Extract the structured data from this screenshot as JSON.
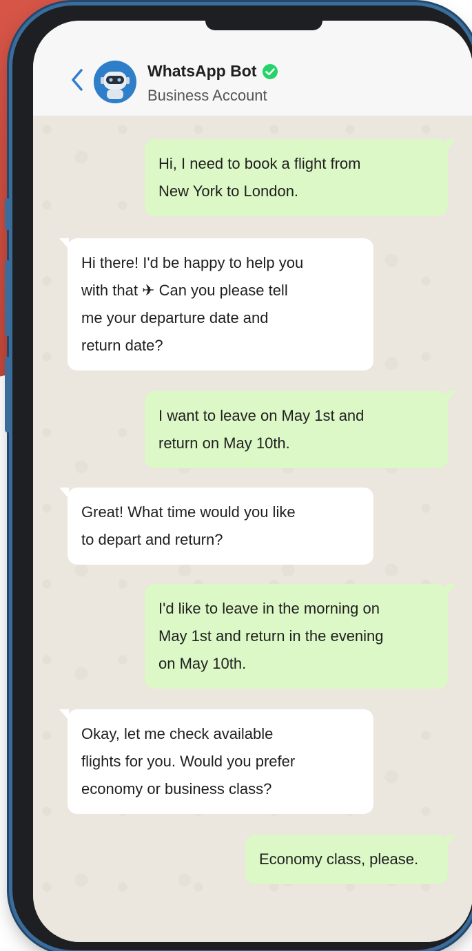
{
  "header": {
    "back_icon": "chevron-left-icon",
    "avatar_icon": "robot-icon",
    "name": "WhatsApp Bot",
    "verified_icon": "verified-check-icon",
    "subtitle": "Business Account"
  },
  "colors": {
    "outgoing_bubble": "#dcf8c6",
    "incoming_bubble": "#ffffff",
    "chat_background": "#ebe6de",
    "verified": "#25d366",
    "accent": "#2f7ec9"
  },
  "messages": [
    {
      "from": "user",
      "text": "Hi, I need to book a flight from\nNew York to London."
    },
    {
      "from": "bot",
      "text": "Hi there! I'd be happy to help you\nwith that ✈ Can you please tell\nme your departure date and\nreturn date?"
    },
    {
      "from": "user",
      "text": "I want to leave on May 1st and\nreturn on May 10th."
    },
    {
      "from": "bot",
      "text": "Great! What time would you like\nto depart and return?"
    },
    {
      "from": "user",
      "text": "I'd like to leave in the morning on\nMay 1st and return in the evening\non May 10th."
    },
    {
      "from": "bot",
      "text": "Okay, let me check available\nflights for you. Would you prefer\neconomy or business class?"
    },
    {
      "from": "user",
      "text": "Economy class, please."
    }
  ]
}
